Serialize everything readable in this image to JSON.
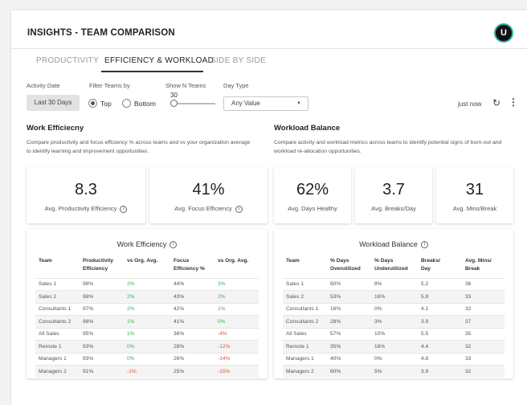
{
  "header": {
    "title": "INSIGHTS - TEAM COMPARISON",
    "avatar_initial": "U"
  },
  "tabs": [
    "PRODUCTIVITY",
    "EFFICIENCY & WORKLOAD",
    "SIDE BY SIDE"
  ],
  "active_tab": "EFFICIENCY & WORKLOAD",
  "filters": {
    "activity_date_label": "Activity Date",
    "activity_date_value": "Last 30 Days",
    "filter_teams_label": "Filter Teams by",
    "top_label": "Top",
    "bottom_label": "Bottom",
    "selected": "Top",
    "show_n_label": "Show N Teams",
    "show_n_value": "30",
    "day_type_label": "Day Type",
    "day_type_value": "Any Value"
  },
  "status": {
    "updated": "just now"
  },
  "work_efficiency": {
    "title": "Work Efficiecny",
    "description_line1": "Compare productivity and focus efficiency % across teams and vs your organization average",
    "description_line2": "to identify learning and improvement opportunities.",
    "metrics": [
      {
        "value": "8.3",
        "label": "Avg. Productivity Efficiency"
      },
      {
        "value": "41%",
        "label": "Avg. Focus Efficiency"
      }
    ],
    "table": {
      "title": "Work Efficiency",
      "headers": [
        [
          "Team"
        ],
        [
          "Productivity",
          "Efficiency"
        ],
        [
          "vs Org. Avg."
        ],
        [
          "Focus",
          "Efficiency %"
        ],
        [
          "vs Org. Avg."
        ]
      ],
      "rows": [
        [
          "Sales 1",
          "98%",
          "2%",
          "44%",
          "3%"
        ],
        [
          "Sales 2",
          "98%",
          "2%",
          "43%",
          "2%"
        ],
        [
          "Consultants 1",
          "97%",
          "2%",
          "42%",
          "1%"
        ],
        [
          "Consultants 2",
          "96%",
          "1%",
          "41%",
          "0%"
        ],
        [
          "All Sales",
          "95%",
          "1%",
          "36%",
          "-4%"
        ],
        [
          "Remote 1",
          "93%",
          "0%",
          "28%",
          "-12%"
        ],
        [
          "Managers 1",
          "93%",
          "0%",
          "26%",
          "-14%"
        ],
        [
          "Managers 2",
          "91%",
          "-1%",
          "25%",
          "-15%"
        ]
      ]
    }
  },
  "workload_balance": {
    "title": "Workload Balance",
    "description_line1": "Compare activity and workload metrics across teams to identify potential signs of burn-out and",
    "description_line2": "workload re-allocation opportunities.",
    "metrics": [
      {
        "value": "62%",
        "label": "Avg. Days Healthy"
      },
      {
        "value": "3.7",
        "label": "Avg. Breaks/Day"
      },
      {
        "value": "31",
        "label": "Avg. Mins/Break"
      }
    ],
    "table": {
      "title": "Workload Balance",
      "headers": [
        [
          "Team"
        ],
        [
          "% Days",
          "Overutilized"
        ],
        [
          "% Days",
          "Underutilized"
        ],
        [
          "Breaks/",
          "Day"
        ],
        [
          "Avg. Mins/",
          "Break"
        ]
      ],
      "rows": [
        [
          "Sales 1",
          "60%",
          "8%",
          "5.2",
          "36"
        ],
        [
          "Sales 2",
          "53%",
          "16%",
          "5.8",
          "33"
        ],
        [
          "Consultants 1",
          "16%",
          "0%",
          "4.1",
          "32"
        ],
        [
          "Consultants 2",
          "28%",
          "3%",
          "3.9",
          "37"
        ],
        [
          "All Sales",
          "57%",
          "10%",
          "5.5",
          "35"
        ],
        [
          "Remote 1",
          "35%",
          "18%",
          "4.4",
          "32"
        ],
        [
          "Managers 1",
          "40%",
          "0%",
          "4.8",
          "33"
        ],
        [
          "Managers 2",
          "60%",
          "5%",
          "3.9",
          "32"
        ]
      ]
    }
  },
  "colors": {
    "accent": "#2bb3a3",
    "positive": "#3db24a",
    "negative": "#e8503f"
  }
}
